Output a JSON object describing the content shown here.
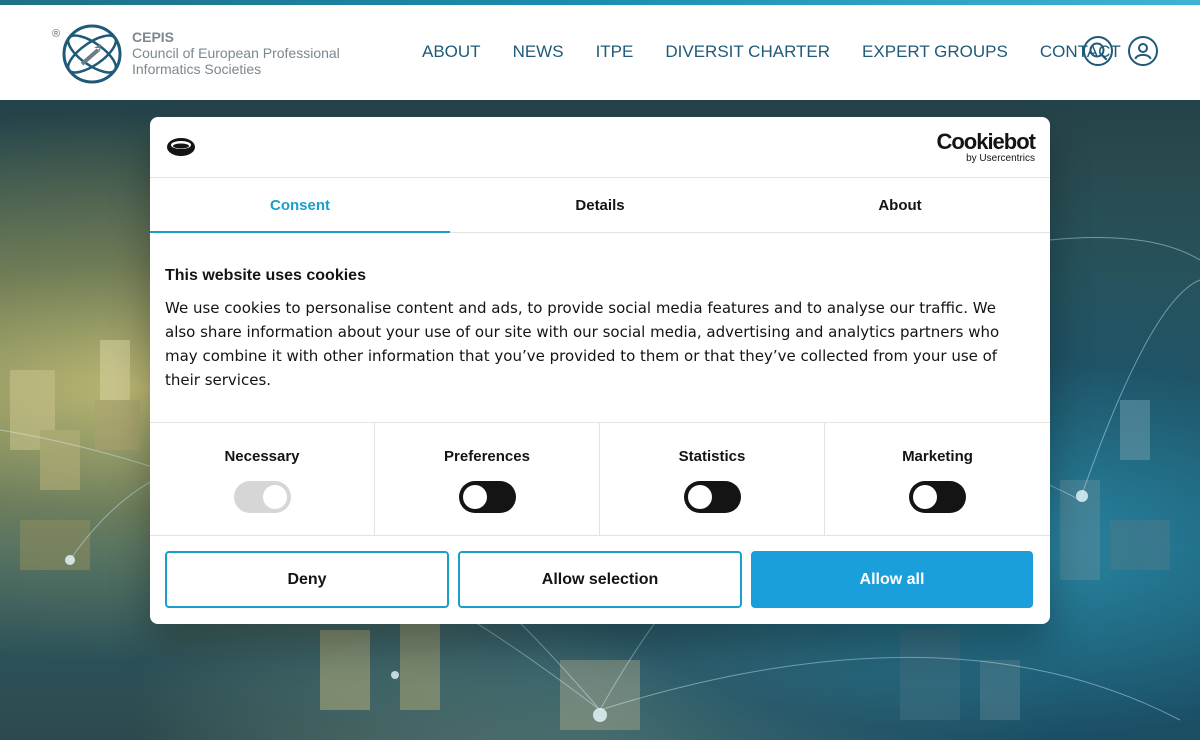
{
  "site": {
    "logo": {
      "registered_mark": "®",
      "title": "CEPIS",
      "subtitle_line1": "Council of European Professional",
      "subtitle_line2": "Informatics Societies"
    },
    "nav": [
      {
        "label": "ABOUT"
      },
      {
        "label": "NEWS"
      },
      {
        "label": "ITPE"
      },
      {
        "label": "DIVERSIT CHARTER"
      },
      {
        "label": "EXPERT GROUPS"
      },
      {
        "label": "CONTACT"
      }
    ],
    "icons": {
      "search": "search-icon",
      "account": "user-icon"
    },
    "colors": {
      "nav_text": "#1f5a78",
      "accent_bar": "#1a8fb0"
    }
  },
  "dialog": {
    "brand": {
      "name": "Cookiebot",
      "by": "by Usercentrics"
    },
    "tabs": [
      {
        "label": "Consent",
        "active": true
      },
      {
        "label": "Details",
        "active": false
      },
      {
        "label": "About",
        "active": false
      }
    ],
    "title": "This website uses cookies",
    "body": "We use cookies to personalise content and ads, to provide social media features and to analyse our traffic. We also share information about your use of our site with our social media, advertising and analytics partners who may combine it with other information that you’ve provided to them or that they’ve collected from your use of their services.",
    "categories": [
      {
        "label": "Necessary",
        "enabled": true,
        "disabled": true
      },
      {
        "label": "Preferences",
        "enabled": false,
        "disabled": false
      },
      {
        "label": "Statistics",
        "enabled": false,
        "disabled": false
      },
      {
        "label": "Marketing",
        "enabled": false,
        "disabled": false
      }
    ],
    "buttons": {
      "deny": "Deny",
      "allow_selection": "Allow selection",
      "allow_all": "Allow all"
    },
    "colors": {
      "accent": "#1a9fcd",
      "primary_button": "#1a9fdb",
      "toggle_off": "#141414",
      "toggle_disabled": "#d6d6d6"
    }
  }
}
